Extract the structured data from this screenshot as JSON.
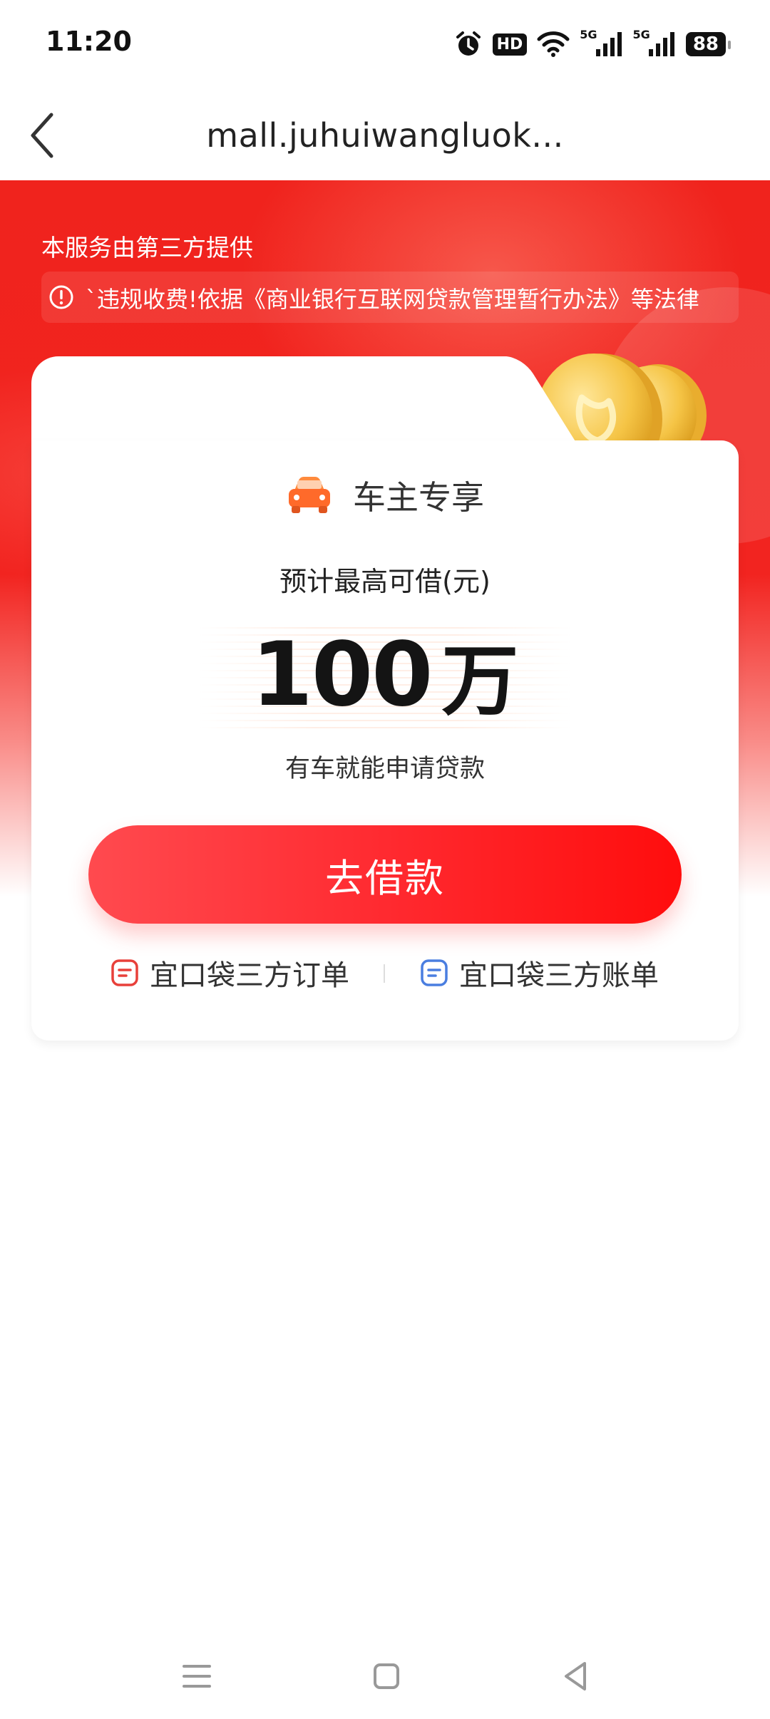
{
  "status_bar": {
    "time": "11:20",
    "hd_label": "HD",
    "signal1_label": "5G",
    "signal2_label": "5G",
    "battery": "88",
    "icons": [
      "alarm-icon",
      "hd-icon",
      "wifi-icon",
      "signal-icon",
      "signal-icon",
      "battery-icon"
    ]
  },
  "nav": {
    "title": "mall.juhuiwangluok...",
    "back_icon": "chevron-left-icon"
  },
  "hero": {
    "provider_text": "本服务由第三方提供",
    "notice_text": "`违规收费!依据《商业银行互联网贷款管理暂行办法》等法律",
    "notice_icon": "info-circle-icon"
  },
  "card": {
    "badge_text": "车主专享",
    "badge_icon": "car-icon",
    "estimate_label": "预计最高可借(元)",
    "amount_number": "100",
    "amount_unit": "万",
    "sub_text": "有车就能申请贷款",
    "cta_label": "去借款",
    "links": [
      {
        "label": "宜口袋三方订单",
        "icon": "order-icon",
        "color": "#e8403a"
      },
      {
        "label": "宜口袋三方账单",
        "icon": "bill-icon",
        "color": "#4a7ee0"
      }
    ]
  },
  "colors": {
    "brand_red": "#f0231d",
    "cta_start": "#ff4a4f",
    "cta_end": "#ff0d0d"
  },
  "system_nav": {
    "icons": [
      "menu-icon",
      "home-square-icon",
      "back-triangle-icon"
    ]
  }
}
